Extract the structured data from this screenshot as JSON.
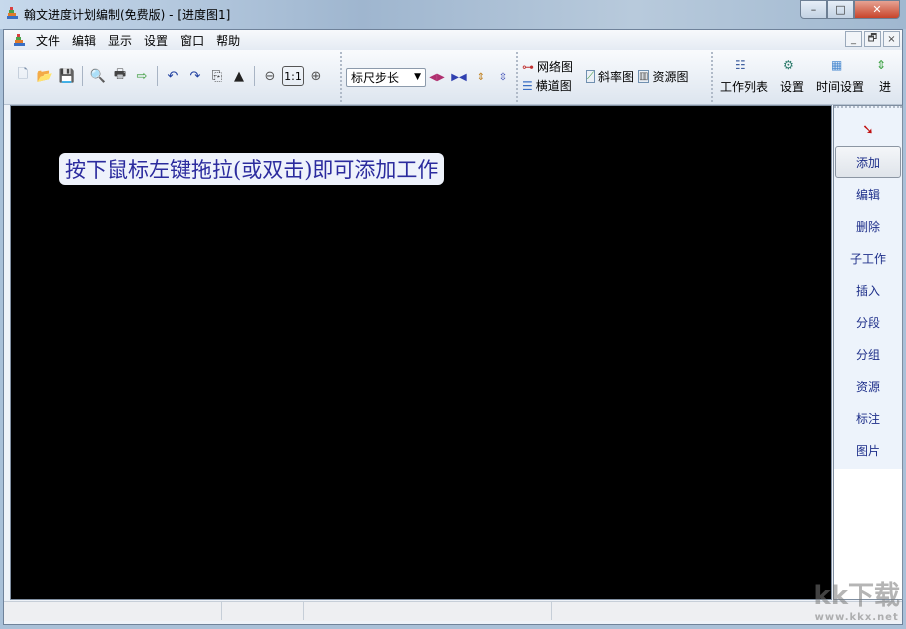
{
  "window": {
    "title": "翰文进度计划编制(免费版) - [进度图1]",
    "minimize": "–",
    "maximize": "□",
    "close": "✕"
  },
  "menu": [
    "文件",
    "编辑",
    "显示",
    "设置",
    "窗口",
    "帮助"
  ],
  "mdi": {
    "minimize": "_",
    "restore": "🗗",
    "close": "×"
  },
  "toolbar": {
    "zoom_reset": "1:1",
    "ruler_select": {
      "value": "标尺步长"
    },
    "network_label": "网络图",
    "bar_label": "横道图",
    "slope_label": "斜率图",
    "resource_label": "资源图",
    "work_list_label": "工作列表",
    "settings_label": "设置",
    "time_settings_label": "时间设置",
    "progress_label": "进"
  },
  "canvas": {
    "hint": "按下鼠标左键拖拉(或双击)即可添加工作"
  },
  "right_panel": {
    "items": [
      "添加",
      "编辑",
      "删除",
      "子工作",
      "插入",
      "分段",
      "分组",
      "资源",
      "标注",
      "图片"
    ],
    "active": "添加"
  },
  "watermark": {
    "line1": "kk下载",
    "line2": "www.kkx.net"
  },
  "colors": {
    "canvas_bg": "#000000",
    "hint_text": "#2b2b9e",
    "panel_text": "#1e2f8a"
  }
}
